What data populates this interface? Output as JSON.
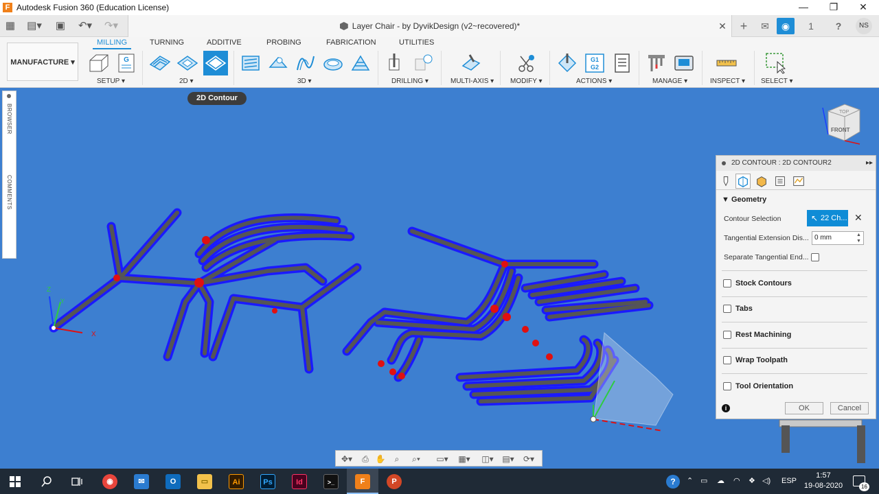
{
  "window": {
    "app_title": "Autodesk Fusion 360 (Education License)",
    "minimize": "—",
    "restore": "❐",
    "close": "✕"
  },
  "quick_access": {
    "grid": "▦",
    "file": "▤▾",
    "save": "▣",
    "undo": "↶▾",
    "redo": "↷▾"
  },
  "document_tab": {
    "title": "Layer Chair - by DyvikDesign (v2~recovered)*",
    "close": "✕"
  },
  "right_controls": {
    "new_tab": "+",
    "chat": "✉",
    "job_status": "◉",
    "notifications": "1",
    "help": "?",
    "user_initials": "NS"
  },
  "workspace": {
    "label": "MANUFACTURE ▾"
  },
  "ribbon_tabs": [
    "MILLING",
    "TURNING",
    "ADDITIVE",
    "PROBING",
    "FABRICATION",
    "UTILITIES"
  ],
  "ribbon_groups": {
    "setup": "SETUP ▾",
    "two_d": "2D ▾",
    "three_d": "3D ▾",
    "drilling": "DRILLING ▾",
    "multi_axis": "MULTI-AXIS ▾",
    "modify": "MODIFY ▾",
    "actions": "ACTIONS ▾",
    "manage": "MANAGE ▾",
    "inspect": "INSPECT ▾",
    "select": "SELECT ▾"
  },
  "ribbon_icon_text": {
    "setup_g": "G",
    "gcode": "G1\nG2"
  },
  "side_strip": {
    "browser": "BROWSER",
    "comments": "COMMENTS"
  },
  "tooltip": "2D Contour",
  "viewcube": {
    "top": "TOP",
    "front": "FRONT"
  },
  "axes": {
    "x": "X",
    "y": "Y",
    "z": "Z"
  },
  "panel": {
    "header": "2D CONTOUR : 2D CONTOUR2",
    "expand": "▸▸",
    "geometry_section": "▼ Geometry",
    "contour_selection_label": "Contour Selection",
    "contour_selection_value": "22 Ch...",
    "clear_selection": "✕",
    "tangential_extension_label": "Tangential Extension Dis...",
    "tangential_extension_value": "0 mm",
    "separate_tangential_label": "Separate Tangential End...",
    "options": [
      "Stock Contours",
      "Tabs",
      "Rest Machining",
      "Wrap Toolpath",
      "Tool Orientation"
    ],
    "info_icon": "i",
    "ok": "OK",
    "cancel": "Cancel"
  },
  "navbar_icons": [
    "✥▾",
    "⎙",
    "✋",
    "⌕",
    "⌕▾",
    "▭▾",
    "▦▾",
    "◫▾",
    "▤▾",
    "⟳▾"
  ],
  "taskbar": {
    "pinned": [
      {
        "name": "chrome",
        "color": "#e8453c",
        "glyph": "◉"
      },
      {
        "name": "mail",
        "color": "#2a7bd0",
        "glyph": "✉"
      },
      {
        "name": "outlook",
        "color": "#0f6cbd",
        "glyph": "O"
      },
      {
        "name": "explorer",
        "color": "#f2c14b",
        "glyph": "▭"
      },
      {
        "name": "illustrator",
        "color": "#331c00",
        "glyph": "Ai"
      },
      {
        "name": "photoshop",
        "color": "#001d34",
        "glyph": "Ps"
      },
      {
        "name": "indesign",
        "color": "#49021f",
        "glyph": "Id"
      },
      {
        "name": "terminal",
        "color": "#111111",
        "glyph": ">_"
      },
      {
        "name": "fusion",
        "color": "#f0801a",
        "glyph": "F"
      },
      {
        "name": "powerpoint",
        "color": "#d24726",
        "glyph": "P"
      }
    ],
    "language": "ESP",
    "time": "1:57",
    "date": "19-08-2020",
    "notifications_count": "16"
  },
  "colors": {
    "viewport": "#3d7fd0",
    "toolpath_outer": "#1a1aff",
    "toolpath_inner": "#555555",
    "accent": "#0f8cd6",
    "taskbar": "#1f2a36"
  }
}
